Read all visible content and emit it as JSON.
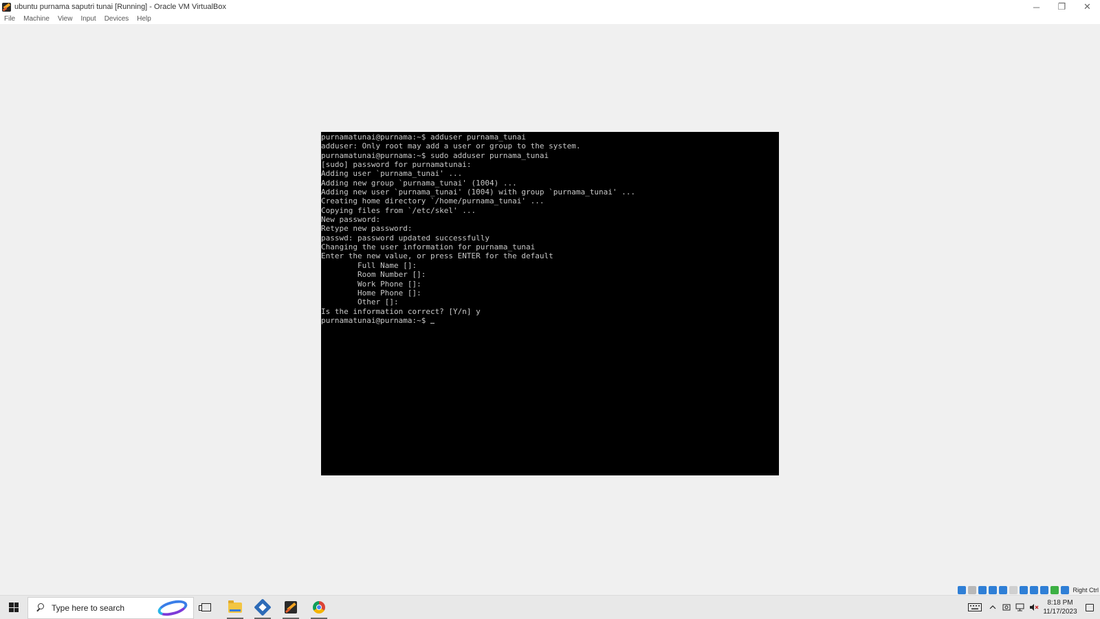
{
  "window": {
    "title": "ubuntu purnama saputri tunai [Running] - Oracle VM VirtualBox",
    "controls": {
      "minimize": "─",
      "restore": "❐",
      "close": "✕"
    }
  },
  "menubar": {
    "items": [
      "File",
      "Machine",
      "View",
      "Input",
      "Devices",
      "Help"
    ]
  },
  "terminal": {
    "lines": [
      "purnamatunai@purnama:~$ adduser purnama_tunai",
      "adduser: Only root may add a user or group to the system.",
      "purnamatunai@purnama:~$ sudo adduser purnama_tunai",
      "[sudo] password for purnamatunai:",
      "Adding user `purnama_tunai' ...",
      "Adding new group `purnama_tunai' (1004) ...",
      "Adding new user `purnama_tunai' (1004) with group `purnama_tunai' ...",
      "Creating home directory `/home/purnama_tunai' ...",
      "Copying files from `/etc/skel' ...",
      "New password:",
      "Retype new password:",
      "passwd: password updated successfully",
      "Changing the user information for purnama_tunai",
      "Enter the new value, or press ENTER for the default",
      "        Full Name []:",
      "        Room Number []:",
      "        Work Phone []:",
      "        Home Phone []:",
      "        Other []:",
      "Is the information correct? [Y/n] y"
    ],
    "prompt": "purnamatunai@purnama:~$ "
  },
  "vm_status_bar": {
    "icons": [
      {
        "name": "hard-disk-icon",
        "color": "#2f7fd6"
      },
      {
        "name": "optical-drive-icon",
        "color": "#b8b8b8"
      },
      {
        "name": "audio-icon",
        "color": "#2f7fd6"
      },
      {
        "name": "network-icon",
        "color": "#2f7fd6"
      },
      {
        "name": "usb-icon",
        "color": "#2f7fd6"
      },
      {
        "name": "shared-folders-icon",
        "color": "#d0d0d0"
      },
      {
        "name": "display-icon",
        "color": "#2f7fd6"
      },
      {
        "name": "video-capture-icon",
        "color": "#2f7fd6"
      },
      {
        "name": "cpu-icon",
        "color": "#2f7fd6"
      },
      {
        "name": "guest-additions-icon",
        "color": "#3cb043"
      },
      {
        "name": "mouse-integration-icon",
        "color": "#2f7fd6"
      }
    ],
    "host_key": "Right Ctrl"
  },
  "taskbar": {
    "search_placeholder": "Type here to search",
    "apps": [
      "task-view",
      "file-explorer",
      "virtualbox-manager",
      "virtualbox-vm",
      "chrome"
    ],
    "clock": {
      "time": "8:18 PM",
      "date": "11/17/2023"
    }
  }
}
